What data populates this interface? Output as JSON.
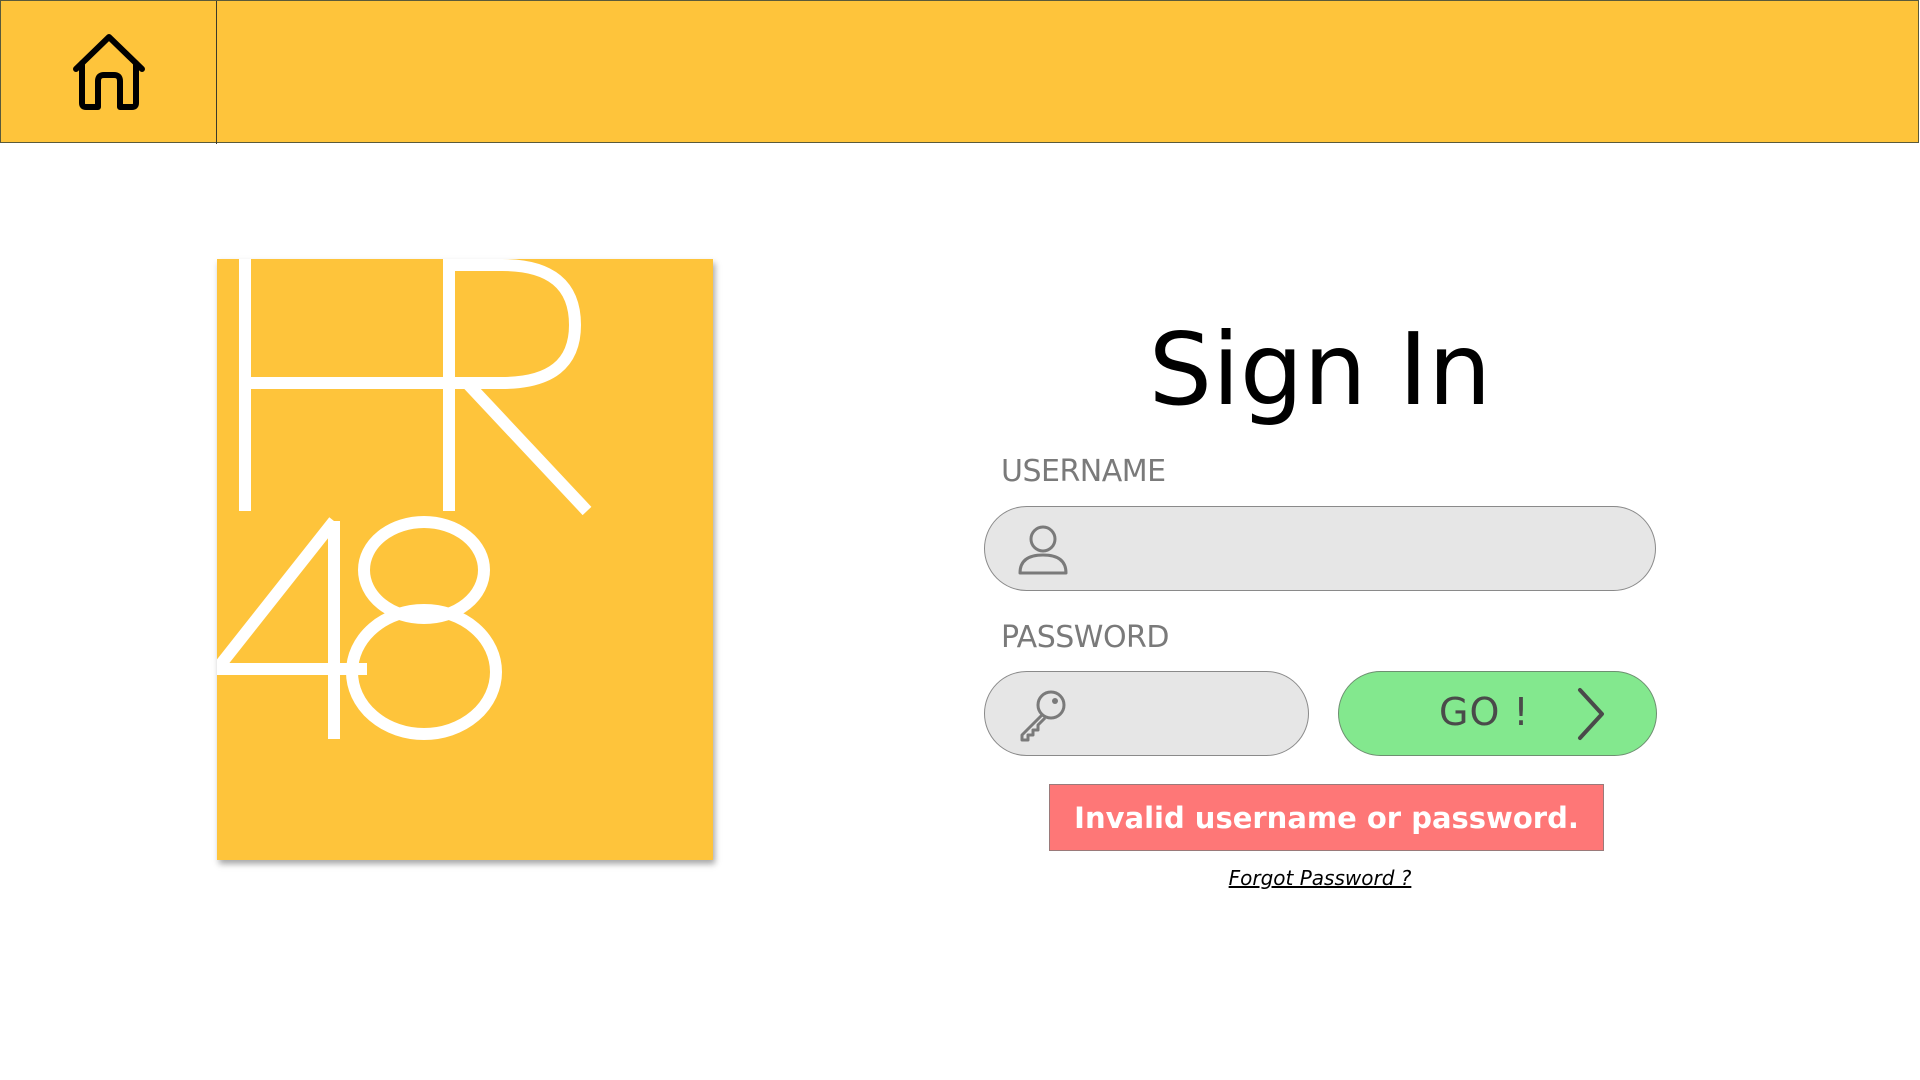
{
  "header": {
    "home_icon": "home-icon"
  },
  "logo": {
    "text_line1": "HR",
    "text_line2": "48"
  },
  "signin": {
    "title": "Sign In",
    "username_label": "USERNAME",
    "username_value": "",
    "username_icon": "user-icon",
    "password_label": "PASSWORD",
    "password_value": "",
    "password_icon": "key-icon",
    "go_label": "GO !",
    "go_icon": "chevron-right-icon",
    "error_message": "Invalid username or password.",
    "forgot_link": "Forgot Password ?"
  },
  "colors": {
    "accent_yellow": "#FEC43B",
    "go_green": "#83E88E",
    "error_red": "#FE7777",
    "field_gray": "#E6E6E6"
  }
}
